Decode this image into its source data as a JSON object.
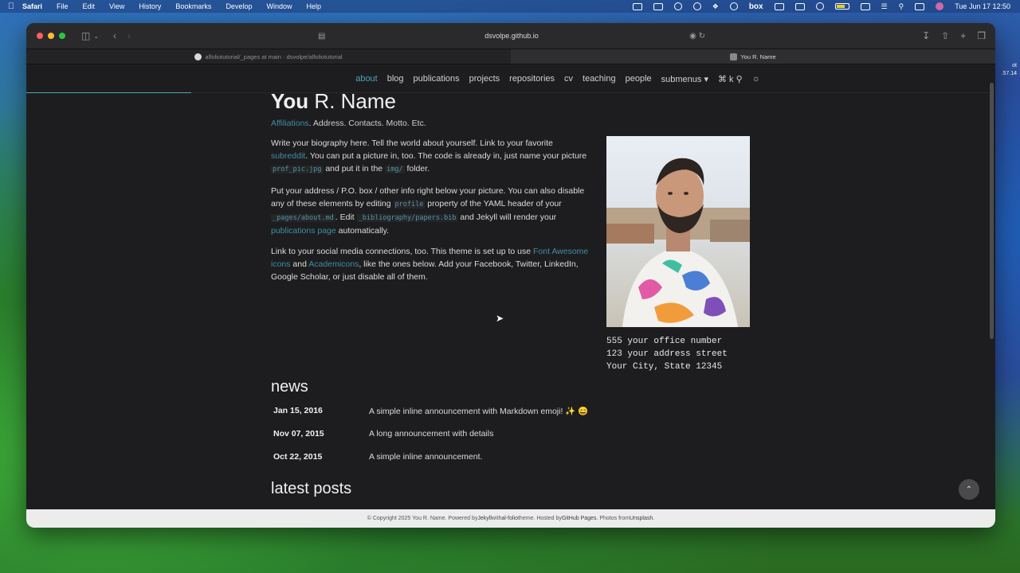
{
  "menubar": {
    "app": "Safari",
    "items": [
      "File",
      "Edit",
      "View",
      "History",
      "Bookmarks",
      "Develop",
      "Window",
      "Help"
    ],
    "clock": "Tue Jun 17  12:50",
    "status_icons": [
      "screen-mirror-icon",
      "a-icon",
      "cloud-icon",
      "sync-icon",
      "dropbox-icon",
      "mask-icon",
      "box-icon",
      "calendar-icon",
      "a-square-icon",
      "play-icon",
      "battery-icon",
      "window-icon",
      "wifi-icon",
      "search-icon",
      "control-center-icon",
      "siri-icon"
    ],
    "box_label": "box"
  },
  "browser": {
    "address": "dsvolpe.github.io",
    "tabs": [
      {
        "label": "alfoliotutorial/_pages at main · dsvolpe/alfoliotutorial",
        "active": false
      },
      {
        "label": "You R. Name",
        "active": true
      }
    ]
  },
  "nav": {
    "items": [
      {
        "label": "about",
        "active": true
      },
      {
        "label": "blog"
      },
      {
        "label": "publications"
      },
      {
        "label": "projects"
      },
      {
        "label": "repositories"
      },
      {
        "label": "cv"
      },
      {
        "label": "teaching"
      },
      {
        "label": "people"
      },
      {
        "label": "submenus ▾"
      },
      {
        "label": "⌘ k"
      }
    ],
    "accent": "#4fa3b5"
  },
  "profile": {
    "first": "You",
    "rest": " R. Name",
    "affiliations_link": "Affiliations",
    "subtitle_rest": ". Address. Contacts. Motto. Etc.",
    "bio1_a": "Write your biography here. Tell the world about yourself. Link to your favorite ",
    "bio1_link": "subreddit",
    "bio1_b": ". You can put a picture in, too. The code is already in, just name your picture ",
    "bio1_code1": "prof_pic.jpg",
    "bio1_c": " and put it in the ",
    "bio1_code2": "img/",
    "bio1_d": " folder.",
    "bio2_a": "Put your address / P.O. box / other info right below your picture. You can also disable any of these elements by editing ",
    "bio2_code1": "profile",
    "bio2_b": " property of the YAML header of your ",
    "bio2_code2": "_pages/about.md",
    "bio2_c": ". Edit ",
    "bio2_code3": "_bibliography/papers.bib",
    "bio2_d": " and Jekyll will render your ",
    "bio2_link": "publications page",
    "bio2_e": " automatically.",
    "bio3_a": "Link to your social media connections, too. This theme is set up to use ",
    "bio3_link1": "Font Awesome icons",
    "bio3_b": " and ",
    "bio3_link2": "Academicons",
    "bio3_c": ", like the ones below. Add your Facebook, Twitter, LinkedIn, Google Scholar, or just disable all of them.",
    "address": "555 your office number\n123 your address street\nYour City, State 12345"
  },
  "news": {
    "heading": "news",
    "items": [
      {
        "date": "Jan 15, 2016",
        "text": "A simple inline announcement with Markdown emoji! ✨ 😄",
        "link": false
      },
      {
        "date": "Nov 07, 2015",
        "text": "A long announcement with details",
        "link": true
      },
      {
        "date": "Oct 22, 2015",
        "text": "A simple inline announcement.",
        "link": false
      }
    ]
  },
  "posts": {
    "heading": "latest posts"
  },
  "footer": {
    "a": "© Copyright 2025 You R. Name. Powered by ",
    "jekyll": "Jekyll",
    "b": " with ",
    "alfolio": "al-folio",
    "c": " theme. Hosted by ",
    "ghpages": "GitHub Pages",
    "d": ". Photos from ",
    "unsplash": "Unsplash",
    "e": "."
  },
  "desktop_side": {
    "line1": "ot",
    "line2": ".57.14"
  }
}
